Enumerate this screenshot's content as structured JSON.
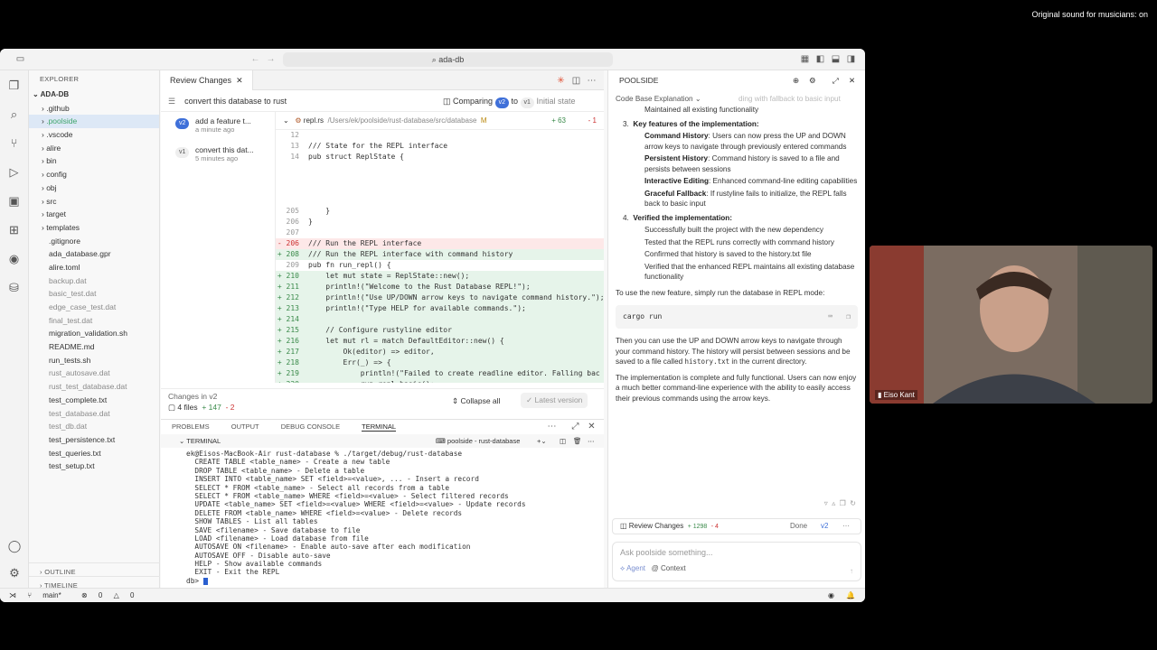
{
  "top": {
    "original_sound": "Original sound for musicians: on"
  },
  "titlebar": {
    "search": "ada-db"
  },
  "explorer": {
    "header": "EXPLORER",
    "root": "ADA-DB",
    "items": [
      {
        "label": ".github",
        "type": "fold"
      },
      {
        "label": ".poolside",
        "type": "fold",
        "selected": true
      },
      {
        "label": ".vscode",
        "type": "fold"
      },
      {
        "label": "alire",
        "type": "fold"
      },
      {
        "label": "bin",
        "type": "fold"
      },
      {
        "label": "config",
        "type": "fold"
      },
      {
        "label": "obj",
        "type": "fold"
      },
      {
        "label": "src",
        "type": "fold"
      },
      {
        "label": "target",
        "type": "fold"
      },
      {
        "label": "templates",
        "type": "fold"
      },
      {
        "label": ".gitignore",
        "type": "file"
      },
      {
        "label": "ada_database.gpr",
        "type": "file"
      },
      {
        "label": "alire.toml",
        "type": "file"
      },
      {
        "label": "backup.dat",
        "type": "file",
        "dim": true
      },
      {
        "label": "basic_test.dat",
        "type": "file",
        "dim": true
      },
      {
        "label": "edge_case_test.dat",
        "type": "file",
        "dim": true
      },
      {
        "label": "final_test.dat",
        "type": "file",
        "dim": true
      },
      {
        "label": "migration_validation.sh",
        "type": "file"
      },
      {
        "label": "README.md",
        "type": "file"
      },
      {
        "label": "run_tests.sh",
        "type": "file"
      },
      {
        "label": "rust_autosave.dat",
        "type": "file",
        "dim": true
      },
      {
        "label": "rust_test_database.dat",
        "type": "file",
        "dim": true
      },
      {
        "label": "test_complete.txt",
        "type": "file"
      },
      {
        "label": "test_database.dat",
        "type": "file",
        "dim": true
      },
      {
        "label": "test_db.dat",
        "type": "file",
        "dim": true
      },
      {
        "label": "test_persistence.txt",
        "type": "file"
      },
      {
        "label": "test_queries.txt",
        "type": "file"
      },
      {
        "label": "test_setup.txt",
        "type": "file"
      }
    ],
    "outline": "OUTLINE",
    "timeline": "TIMELINE"
  },
  "editor": {
    "tab": "Review Changes",
    "review_title": "convert this database to rust",
    "comparing": "Comparing",
    "v2": "v2",
    "to": "to",
    "v1": "v1",
    "initial_state": "Initial state",
    "versions": [
      {
        "badge": "v2",
        "title": "add a feature t...",
        "time": "a minute ago"
      },
      {
        "badge": "v1",
        "title": "convert this dat...",
        "time": "5 minutes ago"
      }
    ],
    "diff_file": "repl.rs",
    "diff_path": "/Users/ek/poolside/rust-database/src/database",
    "diff_mark": "M",
    "diff_added": "+ 63",
    "diff_removed": "- 1",
    "lines": [
      {
        "no": "12",
        "text": "",
        "kind": ""
      },
      {
        "no": "13",
        "text": "/// State for the REPL interface",
        "kind": ""
      },
      {
        "no": "14",
        "text": "pub struct ReplState {",
        "kind": ""
      },
      {
        "no": "",
        "text": "",
        "kind": ""
      },
      {
        "no": "",
        "text": "",
        "kind": ""
      },
      {
        "no": "",
        "text": "",
        "kind": ""
      },
      {
        "no": "",
        "text": "",
        "kind": ""
      },
      {
        "no": "205",
        "text": "    }",
        "kind": ""
      },
      {
        "no": "206",
        "text": "}",
        "kind": ""
      },
      {
        "no": "207",
        "text": "",
        "kind": ""
      },
      {
        "no": "- 206",
        "text": "/// Run the REPL interface",
        "kind": "del"
      },
      {
        "no": "+ 208",
        "text": "/// Run the REPL interface with command history",
        "kind": "add"
      },
      {
        "no": "209",
        "text": "pub fn run_repl() {",
        "kind": ""
      },
      {
        "no": "+ 210",
        "text": "    let mut state = ReplState::new();",
        "kind": "add"
      },
      {
        "no": "+ 211",
        "text": "    println!(\"Welcome to the Rust Database REPL!\");",
        "kind": "add"
      },
      {
        "no": "+ 212",
        "text": "    println!(\"Use UP/DOWN arrow keys to navigate command history.\");",
        "kind": "add"
      },
      {
        "no": "+ 213",
        "text": "    println!(\"Type HELP for available commands.\");",
        "kind": "add"
      },
      {
        "no": "+ 214",
        "text": "",
        "kind": "add"
      },
      {
        "no": "+ 215",
        "text": "    // Configure rustyline editor",
        "kind": "add"
      },
      {
        "no": "+ 216",
        "text": "    let mut rl = match DefaultEditor::new() {",
        "kind": "add"
      },
      {
        "no": "+ 217",
        "text": "        Ok(editor) => editor,",
        "kind": "add"
      },
      {
        "no": "+ 218",
        "text": "        Err(_) => {",
        "kind": "add"
      },
      {
        "no": "+ 219",
        "text": "            println!(\"Failed to create readline editor. Falling bac",
        "kind": "add"
      },
      {
        "no": "+ 220",
        "text": "            run_repl_basic();",
        "kind": "add"
      }
    ],
    "changes_in": "Changes in v2",
    "files": "4 files",
    "plus": "+ 147",
    "minus": "- 2",
    "collapse_all": "Collapse all",
    "latest_version": "Latest version"
  },
  "panel": {
    "tabs": [
      "PROBLEMS",
      "OUTPUT",
      "DEBUG CONSOLE",
      "TERMINAL"
    ],
    "terminal_label": "TERMINAL",
    "terminal_session": "poolside - rust-database",
    "lines": [
      "ek@Eisos-MacBook-Air rust-database % ./target/debug/rust-database",
      "  CREATE TABLE <table_name> - Create a new table",
      "  DROP TABLE <table_name> - Delete a table",
      "  INSERT INTO <table_name> SET <field>=<value>, ... - Insert a record",
      "  SELECT * FROM <table_name> - Select all records from a table",
      "  SELECT * FROM <table_name> WHERE <field>=<value> - Select filtered records",
      "  UPDATE <table_name> SET <field>=<value> WHERE <field>=<value> - Update records",
      "  DELETE FROM <table_name> WHERE <field>=<value> - Delete records",
      "  SHOW TABLES - List all tables",
      "  SAVE <filename> - Save database to file",
      "  LOAD <filename> - Load database from file",
      "  AUTOSAVE ON <filename> - Enable auto-save after each modification",
      "  AUTOSAVE OFF - Disable auto-save",
      "  HELP - Show available commands",
      "  EXIT - Exit the REPL",
      "db> "
    ]
  },
  "status": {
    "branch": "main*",
    "errors": "0",
    "warnings": "0"
  },
  "poolside": {
    "title": "POOLSIDE",
    "mode": "Code Base Explanation",
    "faded": "ding with fallback to basic input",
    "maintained": "Maintained all existing functionality",
    "step3": "Key features of the implementation:",
    "f1_b": "Command History",
    "f1": ": Users can now press the UP and DOWN arrow keys to navigate through previously entered commands",
    "f2_b": "Persistent History",
    "f2": ": Command history is saved to a file and persists between sessions",
    "f3_b": "Interactive Editing",
    "f3": ": Enhanced command-line editing capabilities",
    "f4_b": "Graceful Fallback",
    "f4": ": If rustyline fails to initialize, the REPL falls back to basic input",
    "step4": "Verified the implementation:",
    "v1": "Successfully built the project with the new dependency",
    "v2": "Tested that the REPL runs correctly with command history",
    "v3": "Confirmed that history is saved to the history.txt file",
    "v4": "Verified that the enhanced REPL maintains all existing database functionality",
    "use_text": "To use the new feature, simply run the database in REPL mode:",
    "cmd": "cargo run",
    "then_text_a": "Then you can use the UP and DOWN arrow keys to navigate through your command history. The history will persist between sessions and be saved to a file called ",
    "then_code": "history.txt",
    "then_text_b": " in the current directory.",
    "final_text": "The implementation is complete and fully functional. Users can now enjoy a much better command-line experience with the ability to easily access their previous commands using the arrow keys.",
    "review_label": "Review Changes",
    "review_plus": "+ 1298",
    "review_minus": "- 4",
    "done": "Done",
    "review_v": "v2",
    "ask_placeholder": "Ask poolside something...",
    "agent": "Agent",
    "context": "Context"
  },
  "camera": {
    "name": "Eiso Kant"
  }
}
